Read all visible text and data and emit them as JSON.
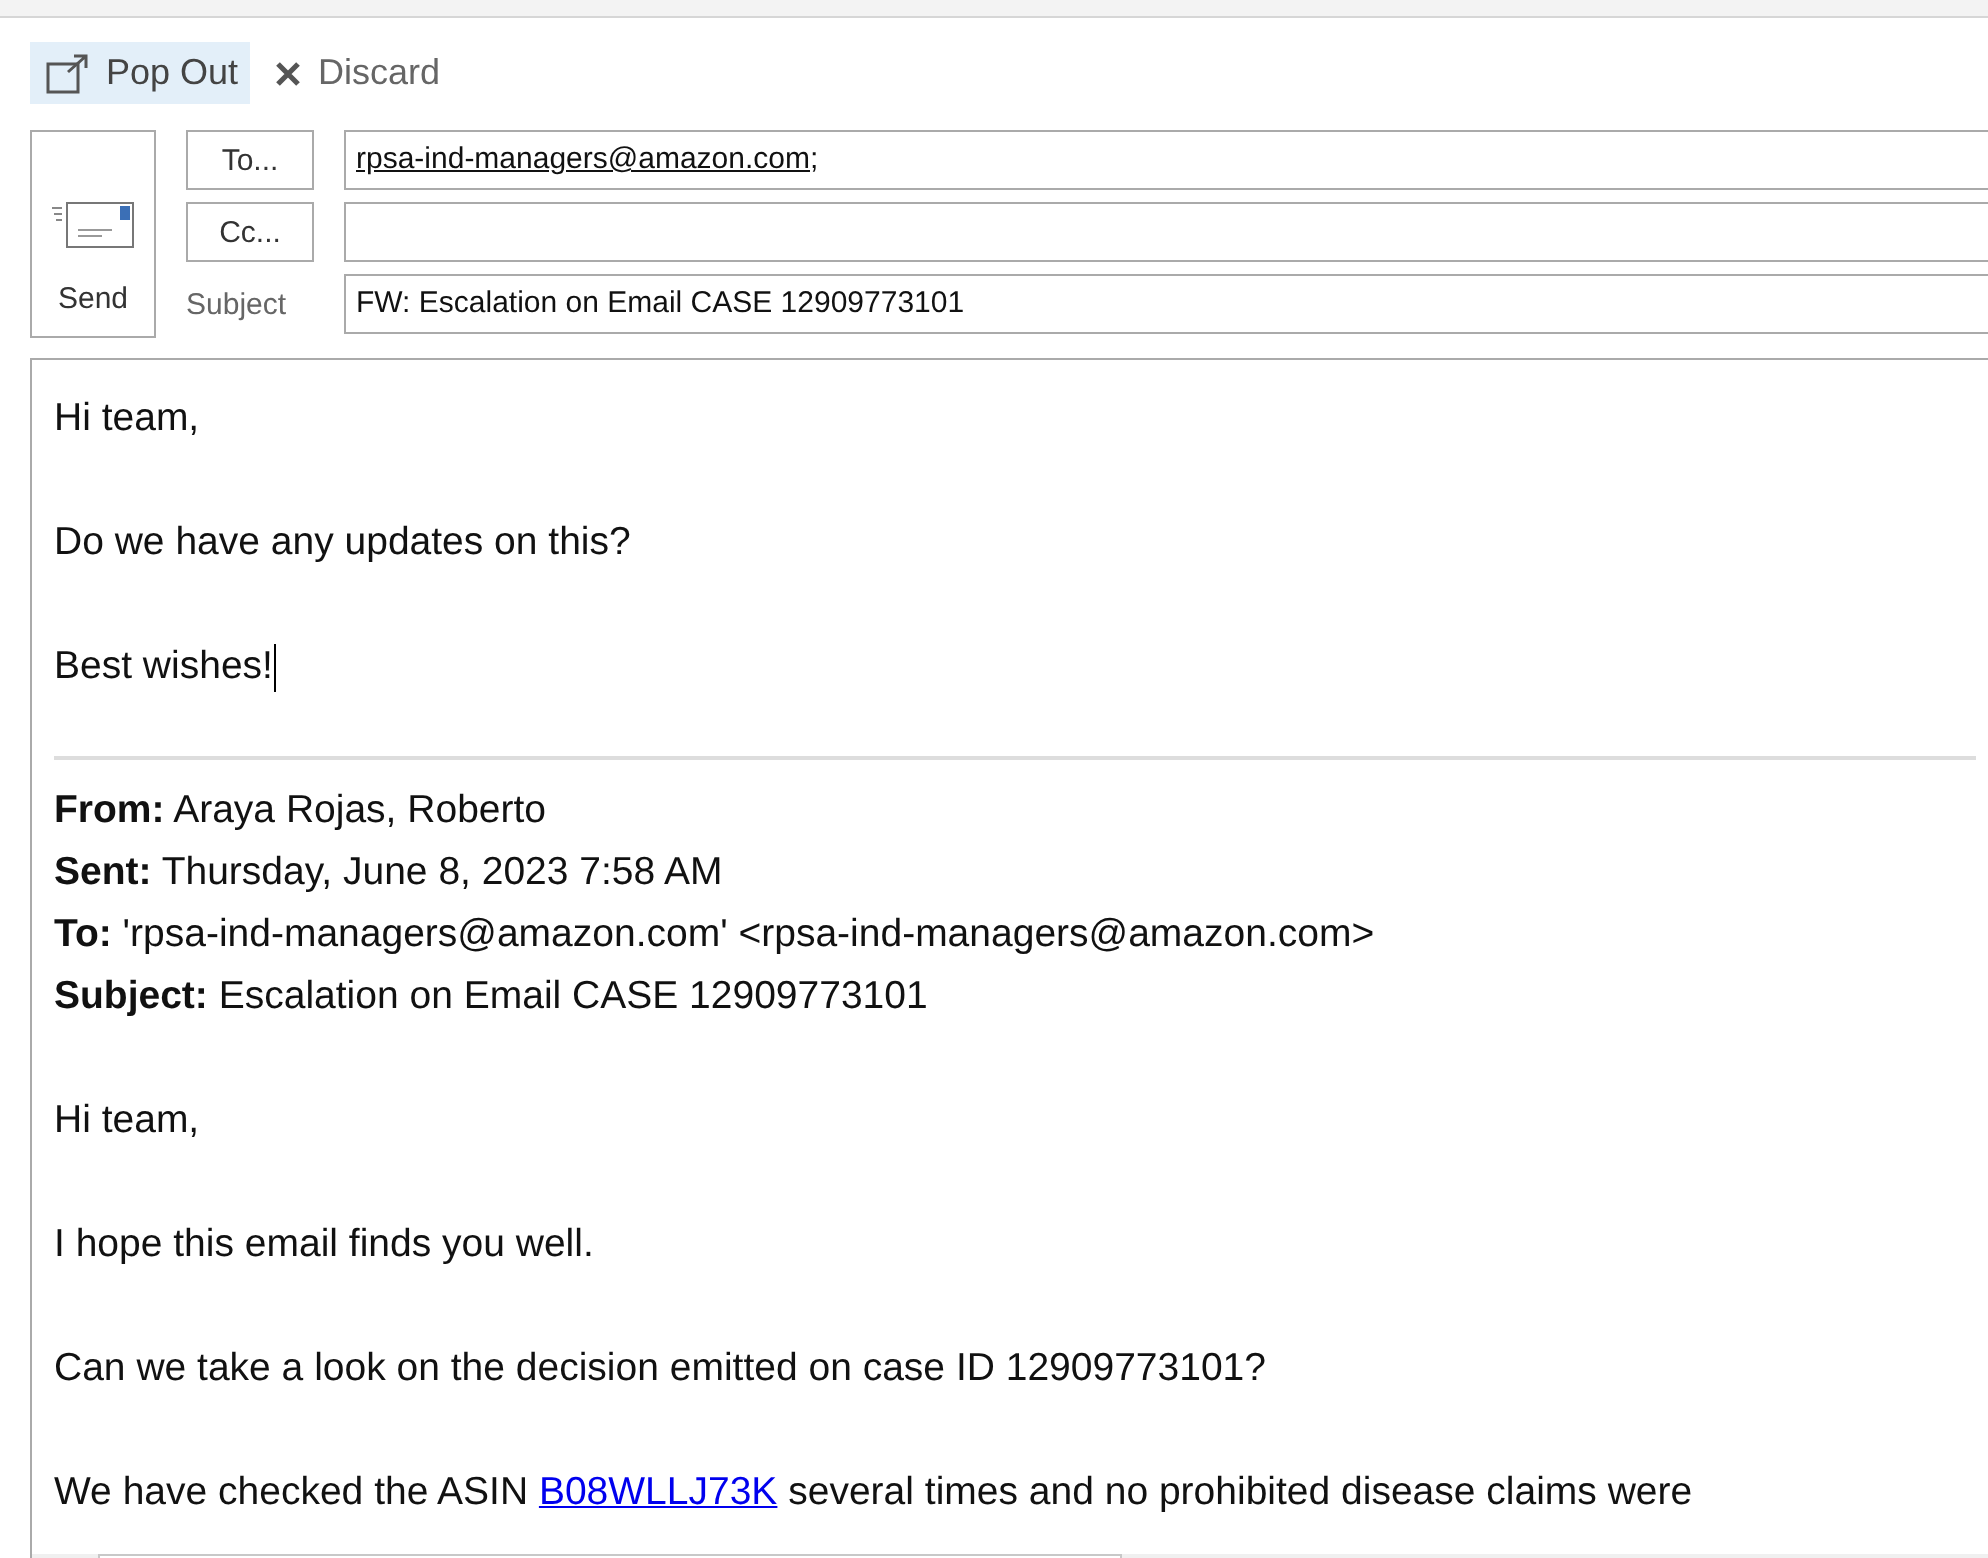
{
  "toolbar": {
    "pop_out": "Pop Out",
    "discard": "Discard"
  },
  "send_button": {
    "label": "Send"
  },
  "to": {
    "button": "To...",
    "recipient": "rpsa-ind-managers@amazon.com",
    "separator": ";"
  },
  "cc": {
    "button": "Cc..."
  },
  "subject": {
    "label": "Subject",
    "value": "FW: Escalation on Email CASE 12909773101"
  },
  "body": {
    "paragraphs": [
      "Hi team,",
      "Do we have any updates on this?",
      "Best wishes!"
    ],
    "quoted_header": [
      {
        "label": "From:",
        "value": "Araya Rojas, Roberto"
      },
      {
        "label": "Sent:",
        "value": "Thursday, June 8, 2023 7:58 AM"
      },
      {
        "label": "To:",
        "value": "'rpsa-ind-managers@amazon.com' <rpsa-ind-managers@amazon.com>"
      },
      {
        "label": "Subject:",
        "value": "Escalation on Email CASE 12909773101"
      }
    ],
    "quoted_paragraphs": [
      {
        "text": "Hi team,"
      },
      {
        "text": "I hope this email finds you well."
      },
      {
        "text": "Can we take a look on the decision emitted on case ID 12909773101?"
      },
      {
        "text": "We have checked the ASIN ",
        "link": "B08WLLJ73K",
        "after": " several times and no prohibited disease claims were"
      }
    ]
  }
}
